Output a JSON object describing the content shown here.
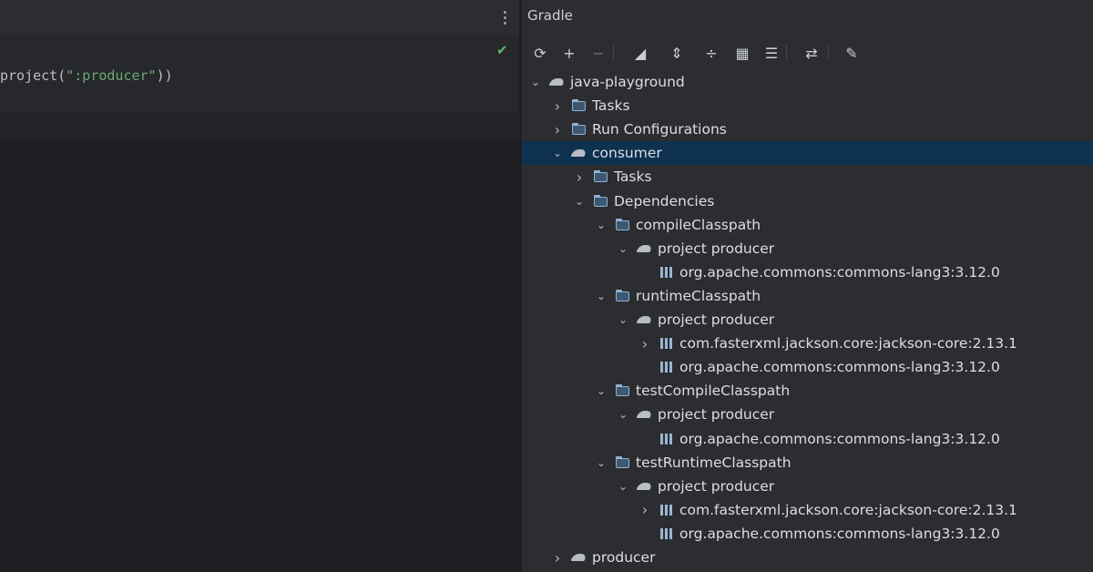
{
  "editor": {
    "code_prefix": "project(",
    "code_string": "\":producer\"",
    "code_suffix": "))"
  },
  "gradle": {
    "title": "Gradle",
    "toolbar": [
      {
        "name": "reload-icon",
        "glyph": "⟳"
      },
      {
        "name": "add-icon",
        "glyph": "+"
      },
      {
        "name": "remove-icon",
        "glyph": "−"
      },
      {
        "name": "gradle-execute-icon",
        "glyph": "◢"
      },
      {
        "name": "expand-all-icon",
        "glyph": "⇕"
      },
      {
        "name": "collapse-all-icon",
        "glyph": "÷"
      },
      {
        "name": "group-modules-icon",
        "glyph": "▦"
      },
      {
        "name": "show-dependencies-icon",
        "glyph": "☰"
      },
      {
        "name": "toggle-offline-icon",
        "glyph": "⇄"
      },
      {
        "name": "build-settings-icon",
        "glyph": "✎"
      }
    ],
    "tree": [
      {
        "label": "java-playground",
        "icon": "gradle",
        "chevron": "down"
      },
      {
        "label": "Tasks",
        "icon": "folder",
        "chevron": "right"
      },
      {
        "label": "Run Configurations",
        "icon": "folder",
        "chevron": "right"
      },
      {
        "label": "consumer",
        "icon": "gradle",
        "chevron": "down",
        "selected": true
      },
      {
        "label": "Tasks",
        "icon": "folder",
        "chevron": "right"
      },
      {
        "label": "Dependencies",
        "icon": "folder",
        "chevron": "down"
      },
      {
        "label": "compileClasspath",
        "icon": "folder",
        "chevron": "down"
      },
      {
        "label": "project producer",
        "icon": "gradle",
        "chevron": "down"
      },
      {
        "label": "org.apache.commons:commons-lang3:3.12.0",
        "icon": "lib",
        "chevron": "none"
      },
      {
        "label": "runtimeClasspath",
        "icon": "folder",
        "chevron": "down"
      },
      {
        "label": "project producer",
        "icon": "gradle",
        "chevron": "down"
      },
      {
        "label": "com.fasterxml.jackson.core:jackson-core:2.13.1",
        "icon": "lib",
        "chevron": "right"
      },
      {
        "label": "org.apache.commons:commons-lang3:3.12.0",
        "icon": "lib",
        "chevron": "none"
      },
      {
        "label": "testCompileClasspath",
        "icon": "folder",
        "chevron": "down"
      },
      {
        "label": "project producer",
        "icon": "gradle",
        "chevron": "down"
      },
      {
        "label": "org.apache.commons:commons-lang3:3.12.0",
        "icon": "lib",
        "chevron": "none"
      },
      {
        "label": "testRuntimeClasspath",
        "icon": "folder",
        "chevron": "down"
      },
      {
        "label": "project producer",
        "icon": "gradle",
        "chevron": "down"
      },
      {
        "label": "com.fasterxml.jackson.core:jackson-core:2.13.1",
        "icon": "lib",
        "chevron": "right"
      },
      {
        "label": "org.apache.commons:commons-lang3:3.12.0",
        "icon": "lib",
        "chevron": "none"
      },
      {
        "label": "producer",
        "icon": "gradle",
        "chevron": "right"
      }
    ]
  }
}
